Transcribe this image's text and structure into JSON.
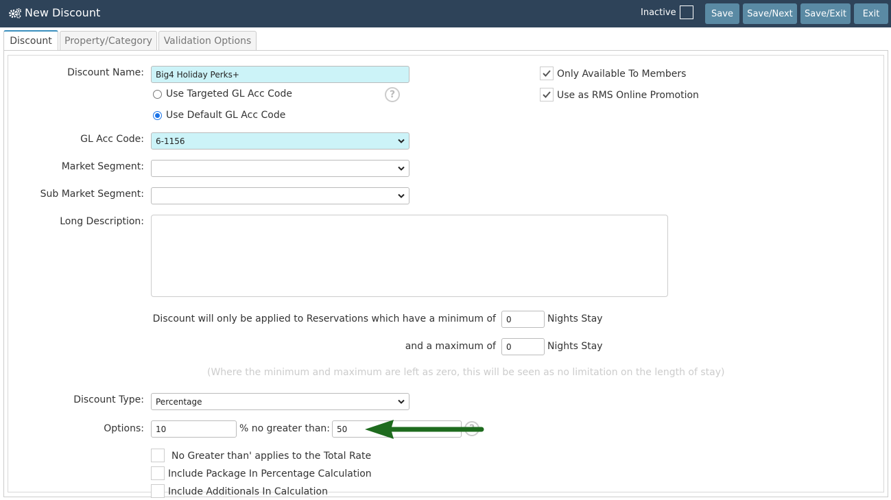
{
  "header": {
    "icon": "gears-icon",
    "title": "New Discount",
    "inactive_label": "Inactive",
    "buttons": {
      "save": "Save",
      "save_next": "Save/Next",
      "save_exit": "Save/Exit",
      "exit": "Exit"
    }
  },
  "tabs": [
    {
      "label": "Discount",
      "active": true
    },
    {
      "label": "Property/Category",
      "active": false
    },
    {
      "label": "Validation Options",
      "active": false
    }
  ],
  "form": {
    "discount_name_label": "Discount Name:",
    "discount_name_value": "Big4 Holiday Perks+",
    "gl_option_targeted": "Use Targeted GL Acc Code",
    "gl_option_default": "Use Default GL Acc Code",
    "gl_option_selected": "default",
    "gl_acc_code_label": "GL Acc Code:",
    "gl_acc_code_value": "6-1156",
    "market_segment_label": "Market Segment:",
    "market_segment_value": "",
    "sub_market_segment_label": "Sub Market Segment:",
    "sub_market_segment_value": "",
    "long_description_label": "Long Description:",
    "long_description_value": "",
    "min_stay_text": "Discount will only be applied to Reservations which have a minimum of",
    "min_stay_value": "0",
    "max_stay_text": "and a maximum of",
    "max_stay_value": "0",
    "nights_stay_label": "Nights Stay",
    "stay_note": "(Where the minimum and maximum are left as zero, this will be seen as no limitation on the length of stay)",
    "discount_type_label": "Discount Type:",
    "discount_type_value": "Percentage",
    "options_label": "Options:",
    "options_percent_value": "10",
    "options_no_greater_text": "% no greater than: $",
    "options_max_value": "50",
    "checkbox_total_rate": "No Greater than' applies to the Total Rate",
    "checkbox_package": "Include Package In Percentage Calculation",
    "checkbox_additionals": "Include Additionals In Calculation",
    "members_only_label": "Only Available To Members",
    "members_only_checked": true,
    "online_promo_label": "Use as RMS Online Promotion",
    "online_promo_checked": true
  },
  "colors": {
    "header_bg": "#2e4359",
    "button_bg": "#5a8aa4",
    "highlight_field": "#ccf3f8",
    "arrow": "#1e6b1e"
  }
}
